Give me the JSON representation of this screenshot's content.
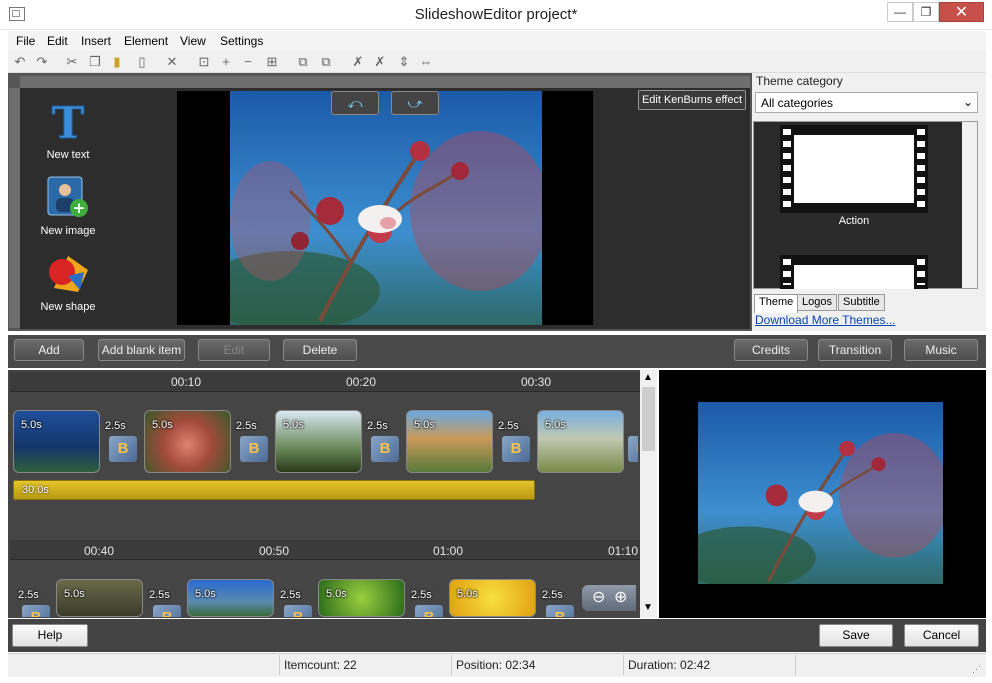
{
  "window": {
    "title": "SlideshowEditor project*",
    "min_glyph": "—",
    "max_glyph": "❐",
    "close_glyph": "✕"
  },
  "menu": [
    "File",
    "Edit",
    "Insert",
    "Element",
    "View",
    "Settings"
  ],
  "tools": {
    "new_text": "New text",
    "new_image": "New image",
    "new_shape": "New shape"
  },
  "preview": {
    "kenburns_label": "Edit KenBurns effect"
  },
  "theme_panel": {
    "category_label": "Theme category",
    "category_value": "All categories",
    "theme_name": "Action",
    "tabs": [
      "Theme",
      "Logos",
      "Subtitle"
    ],
    "download_link": "Download More Themes..."
  },
  "buttons": {
    "add": "Add",
    "add_blank": "Add blank item",
    "edit": "Edit",
    "delete": "Delete",
    "credits": "Credits",
    "transition": "Transition",
    "music": "Music"
  },
  "timeline": {
    "row1_times": [
      "00:10",
      "00:20",
      "00:30"
    ],
    "row2_times": [
      "00:40",
      "00:50",
      "01:00",
      "01:10"
    ],
    "slide_duration": "5.0s",
    "transition_duration": "2.5s",
    "music_duration": "30.0s"
  },
  "bottom": {
    "help": "Help",
    "save": "Save",
    "cancel": "Cancel"
  },
  "status": {
    "itemcount": "Itemcount: 22",
    "position": "Position: 02:34",
    "duration": "Duration: 02:42"
  },
  "colors": {
    "accent": "#e6c52a",
    "link": "#0645ad",
    "close": "#c7504a"
  }
}
